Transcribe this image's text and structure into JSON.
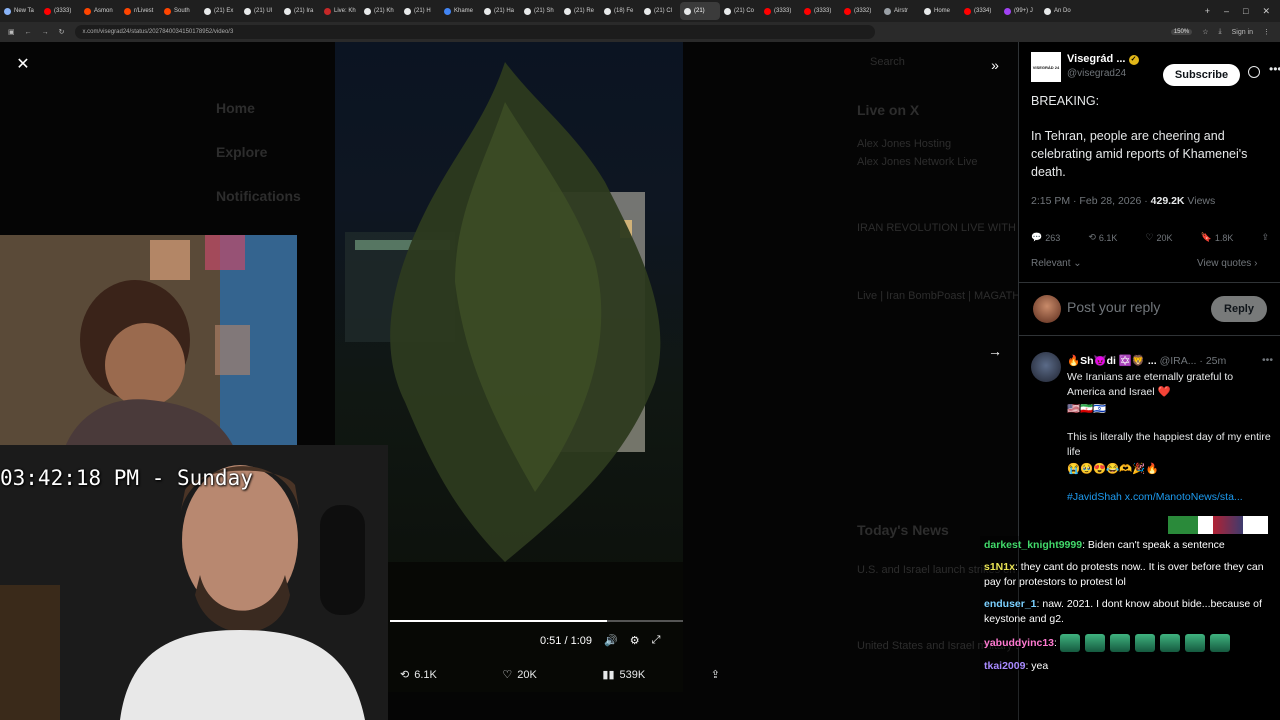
{
  "browser": {
    "tabs": [
      {
        "label": "New Ta",
        "favicon_color": "#8ab4f8",
        "active": false
      },
      {
        "label": "(3333)",
        "favicon_color": "#ff0000",
        "active": false
      },
      {
        "label": "Asmon",
        "favicon_color": "#ff4500",
        "active": false
      },
      {
        "label": "r/Livest",
        "favicon_color": "#ff4500",
        "active": false
      },
      {
        "label": "South",
        "favicon_color": "#ff4500",
        "active": false
      },
      {
        "label": "(21) Ex",
        "favicon_color": "#e7e9ea",
        "active": false
      },
      {
        "label": "(21) Ul",
        "favicon_color": "#e7e9ea",
        "active": false
      },
      {
        "label": "(21) Ira",
        "favicon_color": "#e7e9ea",
        "active": false
      },
      {
        "label": "Live: Kh",
        "favicon_color": "#c62828",
        "active": false
      },
      {
        "label": "(21) Kh",
        "favicon_color": "#e7e9ea",
        "active": false
      },
      {
        "label": "(21) H",
        "favicon_color": "#e7e9ea",
        "active": false
      },
      {
        "label": "Khame",
        "favicon_color": "#4285f4",
        "active": false
      },
      {
        "label": "(21) Ha",
        "favicon_color": "#e7e9ea",
        "active": false
      },
      {
        "label": "(21) Sh",
        "favicon_color": "#e7e9ea",
        "active": false
      },
      {
        "label": "(21) Re",
        "favicon_color": "#e7e9ea",
        "active": false
      },
      {
        "label": "(18) Fe",
        "favicon_color": "#e7e9ea",
        "active": false
      },
      {
        "label": "(21) Cl",
        "favicon_color": "#e7e9ea",
        "active": false
      },
      {
        "label": "(21)",
        "favicon_color": "#e7e9ea",
        "active": true
      },
      {
        "label": "(21) Co",
        "favicon_color": "#e7e9ea",
        "active": false
      },
      {
        "label": "(3333)",
        "favicon_color": "#ff0000",
        "active": false
      },
      {
        "label": "(3333)",
        "favicon_color": "#ff0000",
        "active": false
      },
      {
        "label": "(3332)",
        "favicon_color": "#ff0000",
        "active": false
      },
      {
        "label": "Airstr",
        "favicon_color": "#9aa0a6",
        "active": false
      },
      {
        "label": "Home",
        "favicon_color": "#e7e9ea",
        "active": false
      },
      {
        "label": "(3334)",
        "favicon_color": "#ff0000",
        "active": false
      },
      {
        "label": "(99+) J",
        "favicon_color": "#a142f4",
        "active": false
      },
      {
        "label": "An Do",
        "favicon_color": "#e7e9ea",
        "active": false
      }
    ],
    "url": "x.com/visegrad24/status/2027840034150178952/video/3",
    "zoom": "150%",
    "signin_label": "Sign in"
  },
  "background_feed": {
    "nav": [
      "Home",
      "Explore",
      "Notifications"
    ],
    "search_label": "Search",
    "live_heading": "Live on X",
    "live_items": [
      "Alex Jones Hosting",
      "Alex Jones Network Live",
      "IRAN REVOLUTION LIVE WITH IRANIAN HOSTS",
      "Live | Iran BombPoast | MAGATHON"
    ],
    "news_heading": "Today's News",
    "news_items": [
      "U.S. and Israel launch strikes on Iran",
      "United States and Israel military strikes"
    ]
  },
  "video": {
    "time_current": "0:51",
    "time_total": "1:09",
    "progress": 0.74,
    "reposts": "6.1K",
    "likes": "20K",
    "views": "539K"
  },
  "stream_overlay": {
    "clock": "03:42:18 PM - Sunday"
  },
  "tweet": {
    "author_name": "Visegrád ...",
    "author_handle": "@visegrad24",
    "avatar_text": "VISEGRÁD 24",
    "subscribe_label": "Subscribe",
    "paragraphs": [
      "BREAKING:",
      "In Tehran, people are cheering and celebrating amid reports of Khamenei's death."
    ],
    "timestamp": "2:15 PM · Feb 28, 2026 · ",
    "view_count": "429.2K",
    "views_label": " Views",
    "replies": "263",
    "reposts": "6.1K",
    "likes": "20K",
    "bookmarks": "1.8K",
    "sort_label": "Relevant",
    "view_quotes_label": "View quotes",
    "reply_placeholder": "Post your reply",
    "reply_button": "Reply"
  },
  "reply": {
    "name": "🔥Sh😈di ✡️🦁 ...",
    "handle": "@IRA...",
    "time": "· 25m",
    "lines": [
      "We Iranians are eternally grateful to America and Israel ❤️",
      "🇺🇸🇮🇷🇮🇱",
      "This is literally the happiest day of my entire life",
      "😭🥹😍😂🫶🎉🔥"
    ],
    "link": "#JavidShah x.com/ManotoNews/sta..."
  },
  "chat": [
    {
      "user": "darkest_knight9999",
      "color": "green",
      "text": "Biden can't speak a sentence"
    },
    {
      "user": "s1N1x",
      "color": "yellow",
      "text": "they cant do protests now.. It is over before they can pay for protestors to protest lol"
    },
    {
      "user": "enduser_1",
      "color": "lblue",
      "text": "naw. 2021. I dont know about bide...because of keystone and g2."
    },
    {
      "user": "yabuddyinc13",
      "color": "pink",
      "text": "",
      "emotes": 7
    },
    {
      "user": "tkai2009",
      "color": "purple",
      "text": "yea"
    }
  ]
}
